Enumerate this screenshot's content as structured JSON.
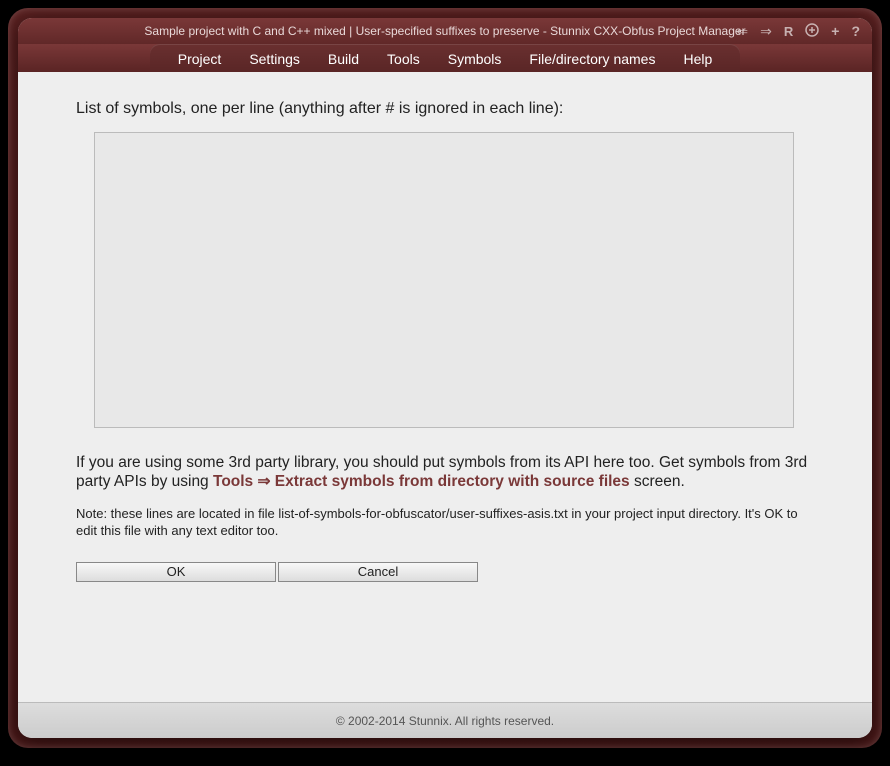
{
  "titlebar": {
    "title": "Sample project with C and C++ mixed | User-specified suffixes to preserve - Stunnix CXX-Obfus Project Manager"
  },
  "menu": {
    "items": [
      {
        "label": "Project"
      },
      {
        "label": "Settings"
      },
      {
        "label": "Build"
      },
      {
        "label": "Tools"
      },
      {
        "label": "Symbols"
      },
      {
        "label": "File/directory names"
      },
      {
        "label": "Help"
      }
    ]
  },
  "main": {
    "label": "List of symbols, one per line (anything after # is ignored in each line):",
    "textarea_value": "",
    "help_prefix": "If you are using some 3rd party library, you should put symbols from its API here too. Get symbols from 3rd party APIs by using ",
    "help_link": "Tools ⇒ Extract symbols from directory with source files",
    "help_suffix": " screen.",
    "note": "Note: these lines are located in file list-of-symbols-for-obfuscator/user-suffixes-asis.txt in your project input directory. It's OK to edit this file with any text editor too.",
    "ok_label": "OK",
    "cancel_label": "Cancel"
  },
  "footer": {
    "copyright": "© 2002-2014 Stunnix. All rights reserved."
  }
}
